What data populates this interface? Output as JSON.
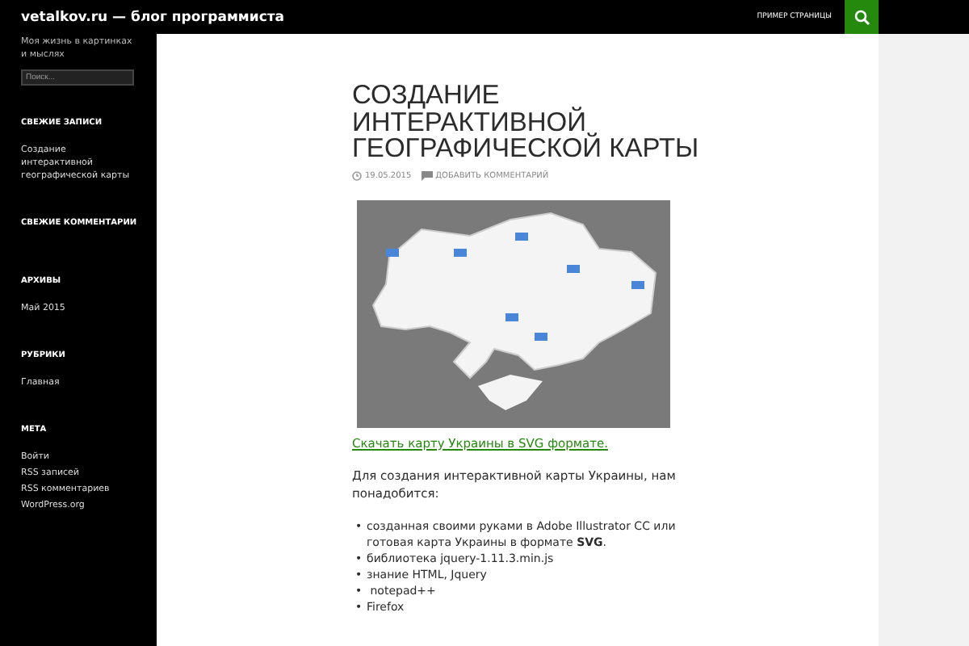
{
  "site": {
    "title": "vetalkov.ru — блог программиста",
    "tagline": "Моя жизнь в картинках и мыслях"
  },
  "nav": {
    "items": [
      {
        "label": "ПРИМЕР СТРАНИЦЫ"
      }
    ]
  },
  "sidebar": {
    "search": {
      "placeholder": "Поиск..."
    },
    "widgets": [
      {
        "title": "СВЕЖИЕ ЗАПИСИ",
        "items": [
          "Создание интерактивной географической карты"
        ]
      },
      {
        "title": "СВЕЖИЕ КОММЕНТАРИИ"
      },
      {
        "title": "АРХИВЫ",
        "items": [
          "Май 2015"
        ]
      },
      {
        "title": "РУБРИКИ",
        "items": [
          "Главная"
        ]
      },
      {
        "title": "МЕТА",
        "items": [
          "Войти",
          "RSS записей",
          "RSS комментариев",
          "WordPress.org"
        ]
      }
    ]
  },
  "post": {
    "title": "СОЗДАНИЕ ИНТЕРАКТИВНОЙ ГЕОГРАФИЧЕСКОЙ КАРТЫ",
    "date": "19.05.2015",
    "comment_link": "ДОБАВИТЬ КОММЕНТАРИЙ",
    "download_link": "Скачать карту Украины в SVG формате.",
    "intro": "Для создания интерактивной карты Украины, нам понадобится:",
    "list": [
      {
        "marker": "•",
        "text": "созданная своими руками в Adobe Illustrator CC или готовая карта Украины в формате **SVG**."
      },
      {
        "marker": "•",
        "text": "библиотека jquery-1.11.3.min.js"
      },
      {
        "marker": "•",
        "text": "знание HTML, Jquery"
      },
      {
        "marker": "•",
        "text": " notepad++"
      },
      {
        "marker": "•",
        "text": "Firefox"
      }
    ]
  }
}
